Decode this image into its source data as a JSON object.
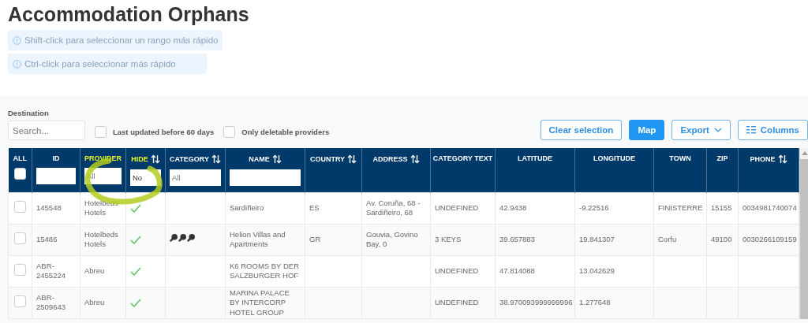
{
  "page": {
    "title": "Accommodation Orphans"
  },
  "hints": [
    "Shift-click para seleccionar un rango más rápido",
    "Ctrl-click para seleccionar más rápido"
  ],
  "filters": {
    "destination_label": "Destination",
    "search": {
      "placeholder": "Search..."
    },
    "checkboxes": [
      {
        "label": "Last updated before 60 days",
        "checked": false
      },
      {
        "label": "Only deletable providers",
        "checked": false
      }
    ]
  },
  "toolbar": [
    {
      "label": "Clear selection",
      "kind": "outline"
    },
    {
      "label": "Map",
      "kind": "primary"
    },
    {
      "label": "Export",
      "kind": "dropdown"
    },
    {
      "label": "Columns",
      "kind": "columns"
    }
  ],
  "table": {
    "select_all": {
      "label": "ALL",
      "checked": false
    },
    "columns": [
      {
        "label": "ID",
        "sortable": false,
        "highlighted": false,
        "filter": {
          "shown": true
        }
      },
      {
        "label": "PROVIDER",
        "sortable": false,
        "highlighted": true,
        "filter": {
          "shown": true,
          "placeholder": "All"
        }
      },
      {
        "label": "HIDE",
        "sortable": true,
        "highlighted": true,
        "filter": {
          "shown": true,
          "value": "No"
        }
      },
      {
        "label": "CATEGORY",
        "sortable": true,
        "highlighted": false,
        "filter": {
          "shown": true,
          "placeholder": "All"
        }
      },
      {
        "label": "NAME",
        "sortable": true,
        "highlighted": false,
        "filter": {
          "shown": true
        }
      },
      {
        "label": "COUNTRY",
        "sortable": true,
        "highlighted": false
      },
      {
        "label": "ADDRESS",
        "sortable": true,
        "highlighted": false
      },
      {
        "label": "CATEGORY TEXT",
        "sortable": false,
        "highlighted": false
      },
      {
        "label": "LATITUDE",
        "sortable": false,
        "highlighted": false
      },
      {
        "label": "LONGITUDE",
        "sortable": false,
        "highlighted": false
      },
      {
        "label": "TOWN",
        "sortable": false,
        "highlighted": false
      },
      {
        "label": "ZIP",
        "sortable": false,
        "highlighted": false
      },
      {
        "label": "PHONE",
        "sortable": true,
        "highlighted": false
      }
    ],
    "rows": [
      {
        "selected": false,
        "id": "145548",
        "provider": "Hotelbeds Hotels",
        "hide": true,
        "name": "Sardiñeiro",
        "country": "ES",
        "address": "Av. Coruña, 68 - Sardiñeiro, 68",
        "category_text": "UNDEFINED",
        "latitude": "42.9438",
        "longitude": "-9.22516",
        "town": "FINISTERRE",
        "zip": "15155",
        "phone": "0034981740074"
      },
      {
        "selected": false,
        "id": "15486",
        "provider": "Hotelbeds Hotels",
        "hide": true,
        "stars": 3,
        "name": "Helion Villas and Apartments",
        "country": "GR",
        "address": "Gouvia, Govino Bay, 0",
        "category_text": "3 KEYS",
        "latitude": "39.657883",
        "longitude": "19.841307",
        "town": "Corfu",
        "zip": "49100",
        "phone": "0030266109159"
      },
      {
        "selected": false,
        "id": "ABR-2455224",
        "provider": "Abreu",
        "hide": true,
        "name": "K6 ROOMS BY DER SALZBURGER HOF",
        "category_text": "UNDEFINED",
        "latitude": "47.814088",
        "longitude": "13.042629"
      },
      {
        "selected": false,
        "id": "ABR-2509643",
        "provider": "Abreu",
        "hide": true,
        "name": "MARINA PALACE BY INTERCORP HOTEL GROUP",
        "category_text": "UNDEFINED",
        "latitude": "38.970093999999996",
        "longitude": "1.277648"
      }
    ]
  }
}
